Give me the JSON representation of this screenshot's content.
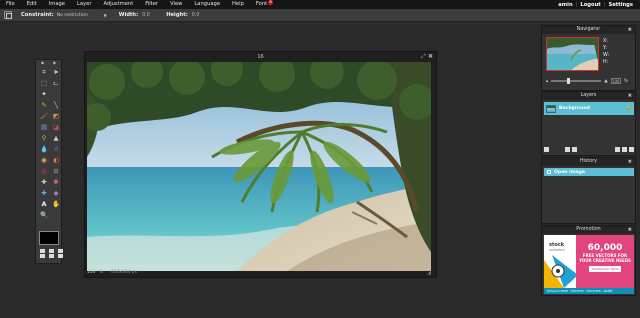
{
  "menubar": {
    "items": [
      "File",
      "Edit",
      "Image",
      "Layer",
      "Adjustment",
      "Filter",
      "View",
      "Language",
      "Help",
      "Font"
    ],
    "font_badge": "9",
    "user": "amin",
    "logout": "Logout",
    "settings": "Settings"
  },
  "options": {
    "constraint_label": "Constraint:",
    "constraint_value": "No restriction",
    "width_label": "Width:",
    "width_value": "0.0",
    "height_label": "Height:",
    "height_value": "0.0"
  },
  "document": {
    "title": "16",
    "zoom": "100",
    "zoom_unit": "%",
    "dimensions": "600x384 px"
  },
  "navigator": {
    "title": "Navigator",
    "x_label": "X:",
    "y_label": "Y:",
    "w_label": "W:",
    "h_label": "H:",
    "zoom": "100",
    "zoom_unit": "%"
  },
  "layers": {
    "title": "Layers",
    "items": [
      {
        "name": "Background"
      }
    ]
  },
  "history": {
    "title": "History",
    "items": [
      {
        "label": "Open image"
      }
    ]
  },
  "promotion": {
    "title": "Promotion",
    "brand": "stock",
    "brand_sub": "unlimited",
    "amount": "60,000",
    "line1": "FREE VECTORS FOR",
    "line2": "YOUR CREATIVE NEEDS",
    "cta": "DOWNLOAD NOW",
    "footer": "ROYALTY-FREE · PHOTOS · VECTORS · MORE"
  },
  "colors": {
    "accent": "#5dbed4",
    "menubar_bg": "#151515",
    "workspace_bg": "#2a2a2a",
    "panel_bg": "#333333",
    "badge": "#d82020",
    "promo": "#e2457d"
  }
}
